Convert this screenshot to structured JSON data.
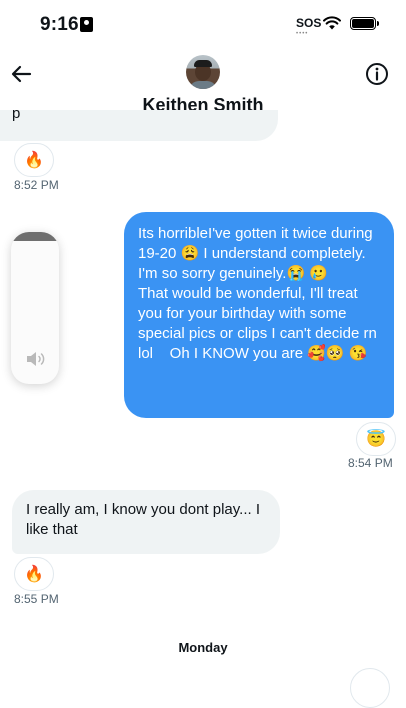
{
  "status_bar": {
    "time": "9:16",
    "sos": "SOS",
    "sos_dots": "••••"
  },
  "header": {
    "contact_name": "Keithen Smith"
  },
  "messages": {
    "partial_text": "p",
    "first_reaction": "🔥",
    "first_time": "8:52 PM",
    "outgoing_text": "Its horribleI've gotten it twice during 19-20 😩 I understand completely. I'm so sorry genuinely.😭 🥲\nThat would be wonderful, I'll treat you for your birthday with some special pics or clips I can't decide rn lol    Oh I KNOW you are 🥰🥺 😘",
    "outgoing_reaction": "😇",
    "outgoing_time": "8:54 PM",
    "incoming_text": "I really am, I know you dont play... I like that",
    "incoming_reaction": "🔥",
    "incoming_time": "8:55 PM"
  },
  "volume": {
    "level": 0.06
  },
  "day_label": "Monday"
}
